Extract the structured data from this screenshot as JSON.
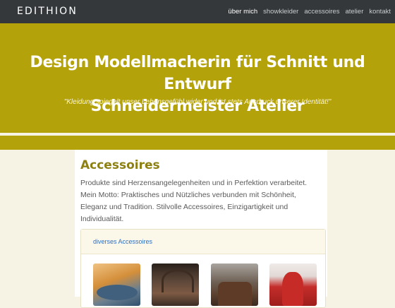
{
  "navbar": {
    "brand": "EDITHION",
    "links": [
      {
        "label": "über mich",
        "active": true
      },
      {
        "label": "showkleider",
        "active": false
      },
      {
        "label": "accessoires",
        "active": false
      },
      {
        "label": "atelier",
        "active": false
      },
      {
        "label": "kontakt",
        "active": false
      }
    ]
  },
  "hero": {
    "title_line1": "Design Modellmacherin für Schnitt und Entwurf",
    "title_line2": "Schneidermeister Atelier",
    "quote": "\"Kleidung spiegelt unser Lebensgefühl wider und ist stets Ausdruck unserer Identität!\""
  },
  "content": {
    "heading": "Accessoires",
    "intro_line1": "Produkte sind Herzensangelegenheiten und in Perfektion verarbeitet.",
    "intro_line2": "Mein Motto: Praktisches und Nützliches verbunden mit Schönheit,",
    "intro_line3": "Eleganz und Tradition. Stilvolle Accessoires, Einzigartigkeit und",
    "intro_line4": "Individualität.",
    "panel": {
      "link": "diverses Accessoires"
    }
  },
  "colors": {
    "navbar": "#34383b",
    "hero": "#b3a20a",
    "heading": "#8c8012",
    "link": "#2f6fc2"
  }
}
